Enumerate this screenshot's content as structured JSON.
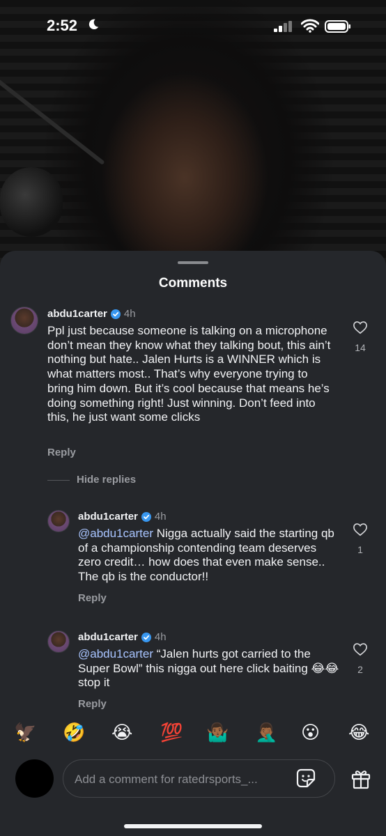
{
  "status_bar": {
    "time": "2:52"
  },
  "sheet": {
    "title": "Comments"
  },
  "comments": [
    {
      "username": "abdu1carter",
      "age": "4h",
      "text": "Ppl just because someone is talking on a microphone don’t mean they know what they talking bout, this ain’t nothing but hate.. Jalen Hurts is a WINNER which is what matters most.. That’s why everyone trying to bring him down. But it’s cool because that means he’s doing something right!  Just winning. Don’t feed into this, he just want some clicks",
      "reply_label": "Reply",
      "likes": "14"
    }
  ],
  "hide_replies_label": "Hide replies",
  "replies": [
    {
      "username": "abdu1carter",
      "age": "4h",
      "mention": "@abdu1carter",
      "text": " Nigga actually said the starting qb of a championship contending team deserves zero credit… how does that even make sense.. The qb is the conductor!!",
      "reply_label": "Reply",
      "likes": "1"
    },
    {
      "username": "abdu1carter",
      "age": "4h",
      "mention": "@abdu1carter",
      "text": " “Jalen hurts got carried to the Super Bowl” this nigga out here click baiting 😂😂 stop it",
      "reply_label": "Reply",
      "likes": "2"
    }
  ],
  "emoji_bar": [
    "🦅",
    "🤣",
    "😭",
    "💯",
    "🤷🏾‍♂️",
    "🤦🏾‍♂️",
    "😮",
    "😂"
  ],
  "composer": {
    "placeholder": "Add a comment for ratedrsports_..."
  },
  "colors": {
    "sheet_bg": "#25272b",
    "mention": "#a8c4ff",
    "verified": "#3897f0"
  },
  "icons": [
    "moon-icon",
    "signal-icon",
    "wifi-icon",
    "battery-icon",
    "verified-badge-icon",
    "heart-icon",
    "sticker-icon",
    "gift-icon"
  ]
}
